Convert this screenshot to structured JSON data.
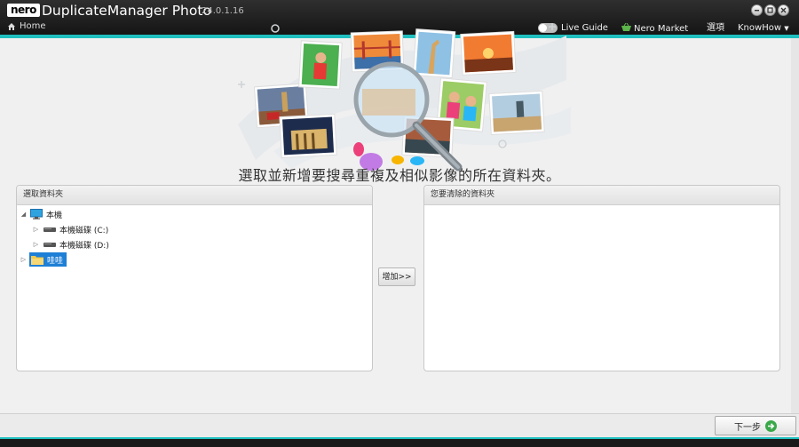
{
  "window": {
    "logo": "nero",
    "title": "DuplicateManager Photo",
    "version": "24.0.1.16",
    "controls": [
      "minimize-icon",
      "restore-icon",
      "close-icon"
    ]
  },
  "topbar": {
    "home_label": "Home",
    "live_guide_label": "Live Guide",
    "live_guide_enabled": false,
    "market_label": "Nero Market",
    "options_label": "選項",
    "user_label": "KnowHow"
  },
  "main": {
    "headline": "選取並新增要搜尋重複及相似影像的所在資料夾。",
    "left_panel": {
      "header": "選取資料夾",
      "tree": [
        {
          "label": "本機",
          "icon": "monitor-icon",
          "expanded": true
        },
        {
          "label": "本機磁碟 (C:)",
          "icon": "drive-icon",
          "expanded": false
        },
        {
          "label": "本機磁碟 (D:)",
          "icon": "drive-icon",
          "expanded": false
        },
        {
          "label": "哇哇",
          "icon": "folder-icon",
          "expanded": false,
          "selected": true
        }
      ]
    },
    "add_button": "增加>>",
    "right_panel": {
      "header": "您要清除的資料夾"
    }
  },
  "footer": {
    "next_label": "下一步"
  },
  "colors": {
    "accent": "#1fbfbf",
    "selection": "#1e7fd6",
    "next_icon": "#3aa84a",
    "titlebar": "#1a1a1a"
  }
}
